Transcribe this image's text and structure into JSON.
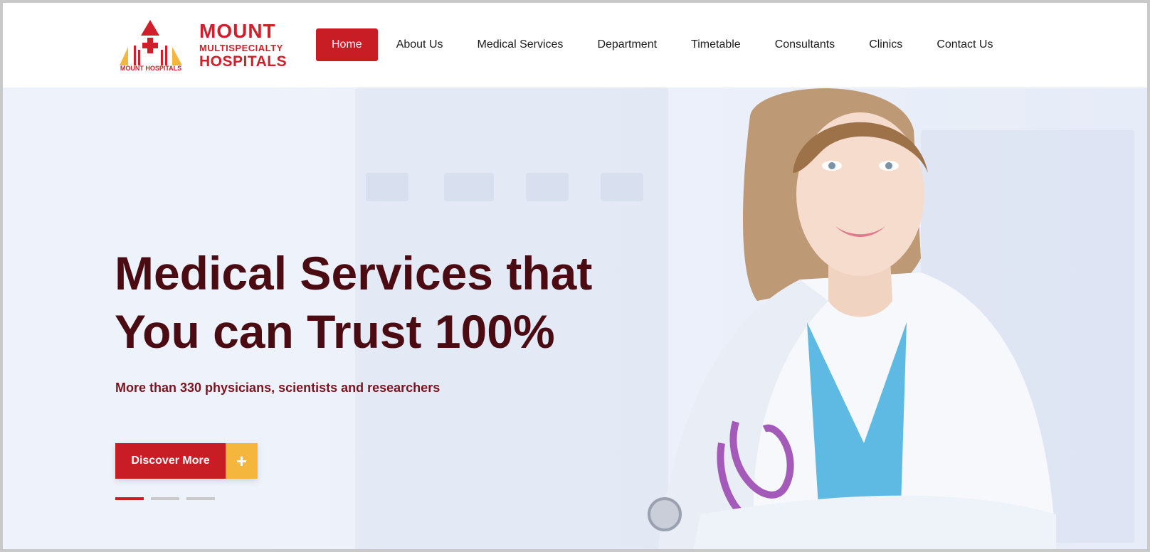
{
  "logo": {
    "line1": "MOUNT",
    "line2": "MULTISPECIALTY",
    "line3": "HOSPITALS",
    "mark_caption": "MOUNT HOSPITALS",
    "brand_red": "#d01f2b",
    "brand_yellow": "#f4b63d"
  },
  "nav": {
    "items": [
      {
        "label": "Home",
        "active": true
      },
      {
        "label": "About Us"
      },
      {
        "label": "Medical Services"
      },
      {
        "label": "Department"
      },
      {
        "label": "Timetable"
      },
      {
        "label": "Consultants"
      },
      {
        "label": "Clinics"
      },
      {
        "label": "Contact Us"
      }
    ],
    "active_color": "#c91d25"
  },
  "hero": {
    "headline_line1": "Medical Services that",
    "headline_line2": "You can Trust 100%",
    "subline": "More than 330 physicians, scientists and researchers",
    "cta_label": "Discover More",
    "cta_icon": "plus-icon",
    "slides_total": 3,
    "active_slide": 1,
    "headline_color": "#4a0c12"
  }
}
